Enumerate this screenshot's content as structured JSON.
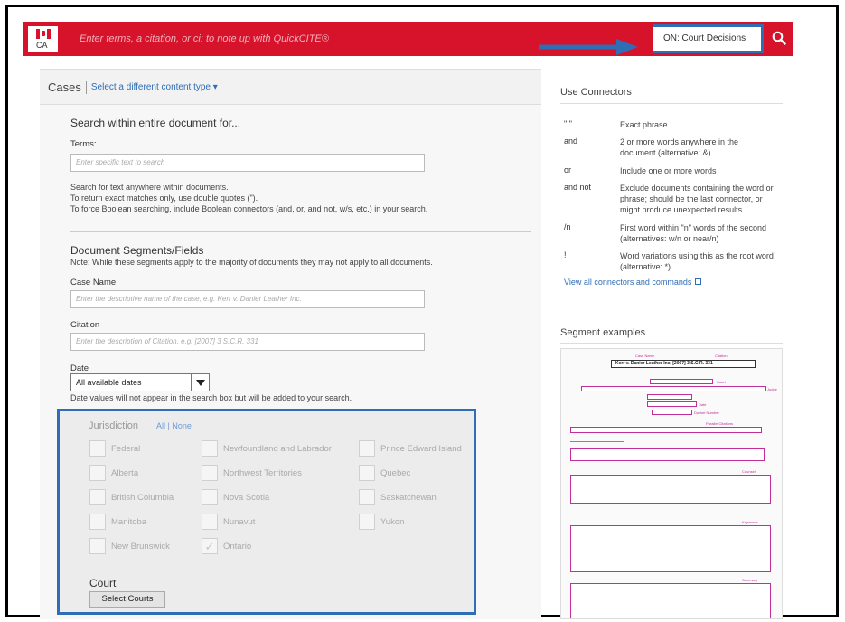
{
  "header": {
    "flag_code": "CA",
    "search_placeholder": "Enter terms, a citation, or ci: to note up with QuickCITE®",
    "content_select": "ON: Court Decisions"
  },
  "left": {
    "title": "Cases",
    "change_type": "Select a different content type ▾",
    "search_within_title": "Search within entire document for...",
    "terms_label": "Terms:",
    "terms_placeholder": "Enter specific text to search",
    "help_lines": [
      "Search for text anywhere within documents.",
      "To return exact matches only, use double quotes (\").",
      "To force Boolean searching, include Boolean connectors (and, or, and not, w/s, etc.) in your search."
    ],
    "segments_title": "Document Segments/Fields",
    "segments_note": "Note: While these segments apply to the majority of documents they may not apply to all documents.",
    "case_name_label": "Case Name",
    "case_name_placeholder": "Enter the descriptive name of the case, e.g. Kerr v. Danier Leather Inc.",
    "citation_label": "Citation",
    "citation_placeholder": "Enter the description of Citation, e.g. [2007] 3 S.C.R. 331",
    "date_label": "Date",
    "date_value": "All available dates",
    "date_note": "Date values will not appear in the search box but will be added to your search."
  },
  "jurisdiction": {
    "title": "Jurisdiction",
    "all": "All",
    "sep": "|",
    "none": "None",
    "items": [
      {
        "label": "Federal",
        "checked": false
      },
      {
        "label": "Newfoundland and Labrador",
        "checked": false
      },
      {
        "label": "Prince Edward Island",
        "checked": false
      },
      {
        "label": "Alberta",
        "checked": false
      },
      {
        "label": "Northwest Territories",
        "checked": false
      },
      {
        "label": "Quebec",
        "checked": false
      },
      {
        "label": "British Columbia",
        "checked": false
      },
      {
        "label": "Nova Scotia",
        "checked": false
      },
      {
        "label": "Saskatchewan",
        "checked": false
      },
      {
        "label": "Manitoba",
        "checked": false
      },
      {
        "label": "Nunavut",
        "checked": false
      },
      {
        "label": "Yukon",
        "checked": false
      },
      {
        "label": "New Brunswick",
        "checked": false
      },
      {
        "label": "Ontario",
        "checked": true
      }
    ],
    "court_title": "Court",
    "court_button": "Select Courts"
  },
  "connectors": {
    "title": "Use Connectors",
    "rows": [
      {
        "sym": "\" \"",
        "desc": "Exact phrase"
      },
      {
        "sym": "and",
        "desc": "2 or more words anywhere in the document (alternative: &)"
      },
      {
        "sym": "or",
        "desc": "Include one or more words"
      },
      {
        "sym": "and not",
        "desc": "Exclude documents containing the word or phrase; should be the last connector, or might produce unexpected results"
      },
      {
        "sym": "/n",
        "desc": "First word within \"n\" words of the second (alternatives: w/n or near/n)"
      },
      {
        "sym": "!",
        "desc": "Word variations using this as the root word (alternative: *)"
      }
    ],
    "view_all": "View all connectors and commands"
  },
  "segments": {
    "title": "Segment examples",
    "case_title": "Kerr v. Danier Leather Inc. [2007] 3 S.C.R. 331",
    "labels": [
      "Case Name",
      "Citation",
      "Court",
      "Judge",
      "Date",
      "Docket Number",
      "Parallel Citations",
      "Counsel",
      "Keywords",
      "Summary"
    ]
  },
  "colors": {
    "brand_red": "#d6132b",
    "highlight_blue": "#2f6db5",
    "segment_magenta": "#c22f9b"
  }
}
